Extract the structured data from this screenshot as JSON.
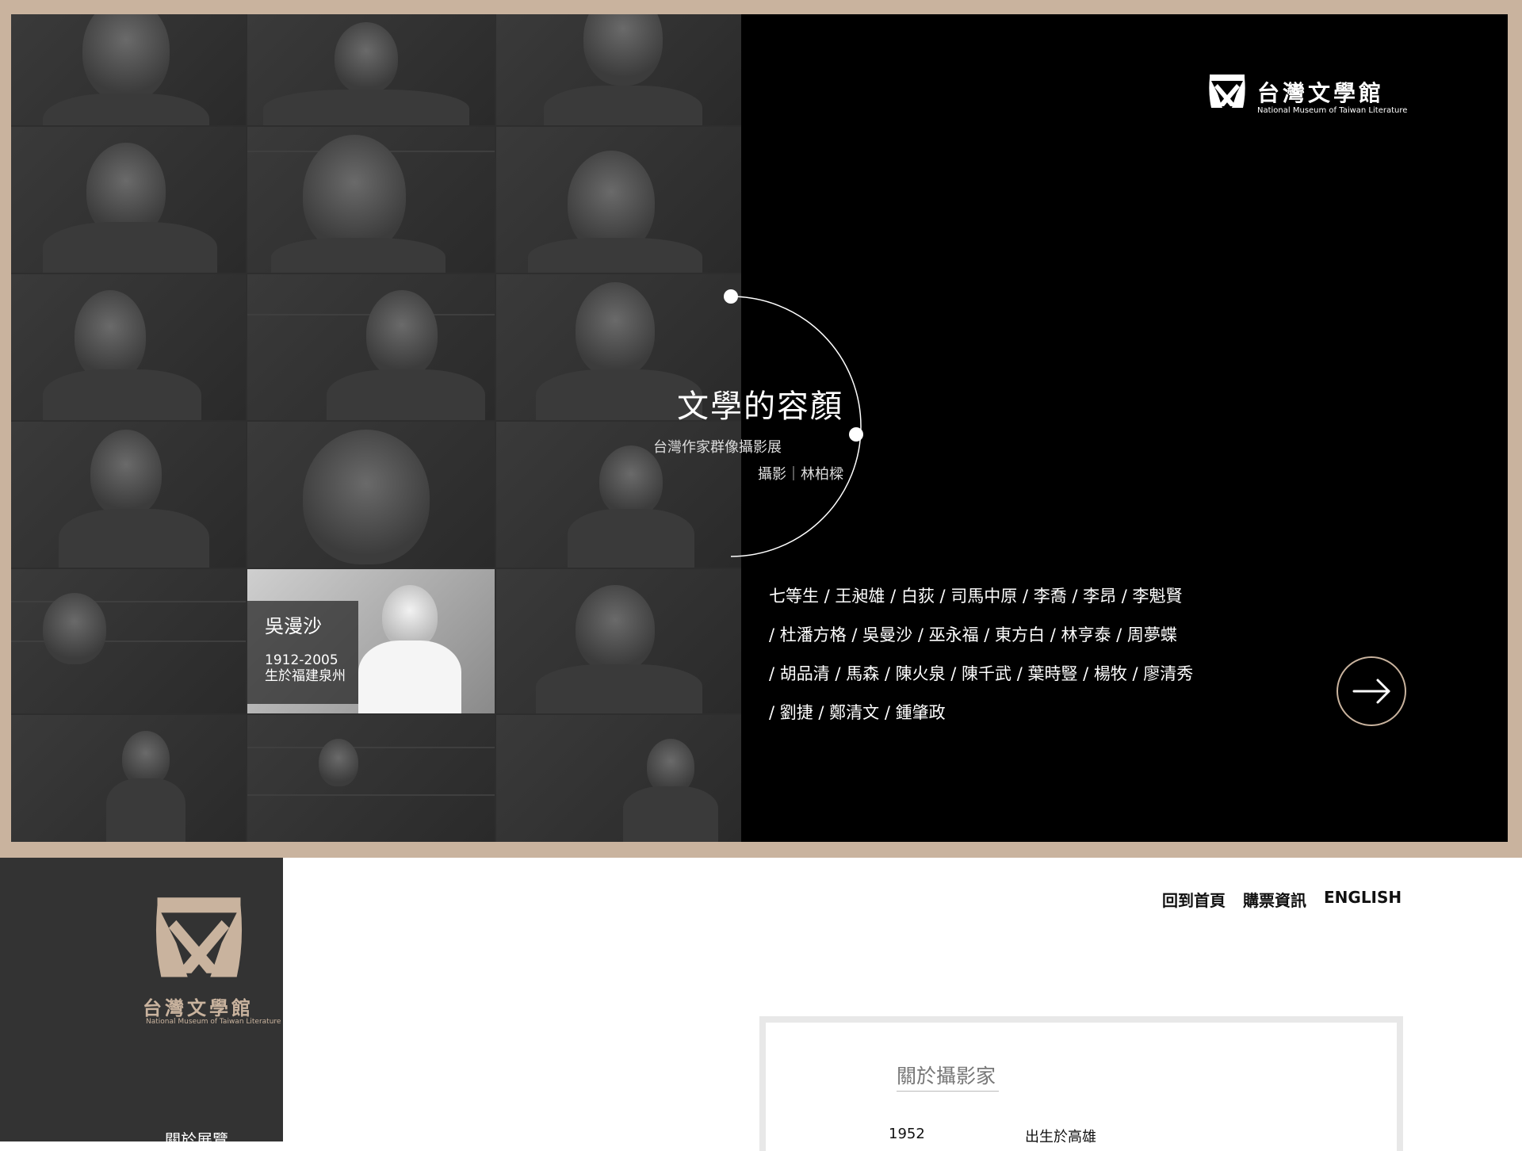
{
  "brand": {
    "name_zh": "台灣文學館",
    "name_en": "National Museum of Taiwan Literature"
  },
  "hero": {
    "title": "文學的容顏",
    "subtitle": "台灣作家群像攝影展",
    "credit": "攝影｜林柏樑",
    "featured": {
      "name": "吳漫沙",
      "years": "1912-2005",
      "origin": "生於福建泉州"
    },
    "writers_lines": [
      "七等生 / 王昶雄 / 白荻 / 司馬中原 / 李喬 / 李昂 / 李魁賢",
      "/ 杜潘方格 / 吳曼沙 / 巫永福 / 東方白 / 林亨泰 / 周夢蝶",
      "/ 胡品清 / 馬森 / 陳火泉 / 陳千武 / 葉時豎 / 楊牧 / 廖清秀",
      "/ 劉捷 / 鄭清文 / 鍾肇政"
    ]
  },
  "nav": {
    "home": "回到首頁",
    "tickets": "購票資訊",
    "english": "ENGLISH"
  },
  "sidebar": {
    "menu_item": "關於展覽"
  },
  "about": {
    "heading": "關於攝影家",
    "rows": [
      {
        "year": "1952",
        "text": "出生於高雄"
      }
    ]
  },
  "colors": {
    "frame": "#c9b39e",
    "sidebar": "#333333",
    "accent": "#c9b39e"
  }
}
